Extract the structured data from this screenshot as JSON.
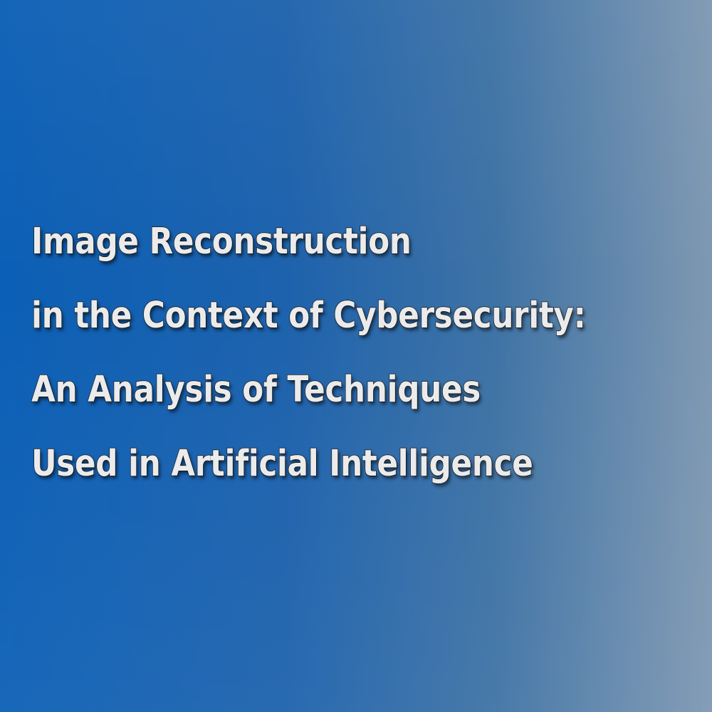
{
  "title": {
    "lines": [
      "Image Reconstruction",
      "in the Context of Cybersecurity:",
      "An Analysis of Techniques",
      "Used in Artificial Intelligence"
    ]
  },
  "colors": {
    "background_left": "#0b5fb6",
    "background_right": "#7f98b2",
    "text": "#ebebeb",
    "text_outline": "#161616"
  }
}
